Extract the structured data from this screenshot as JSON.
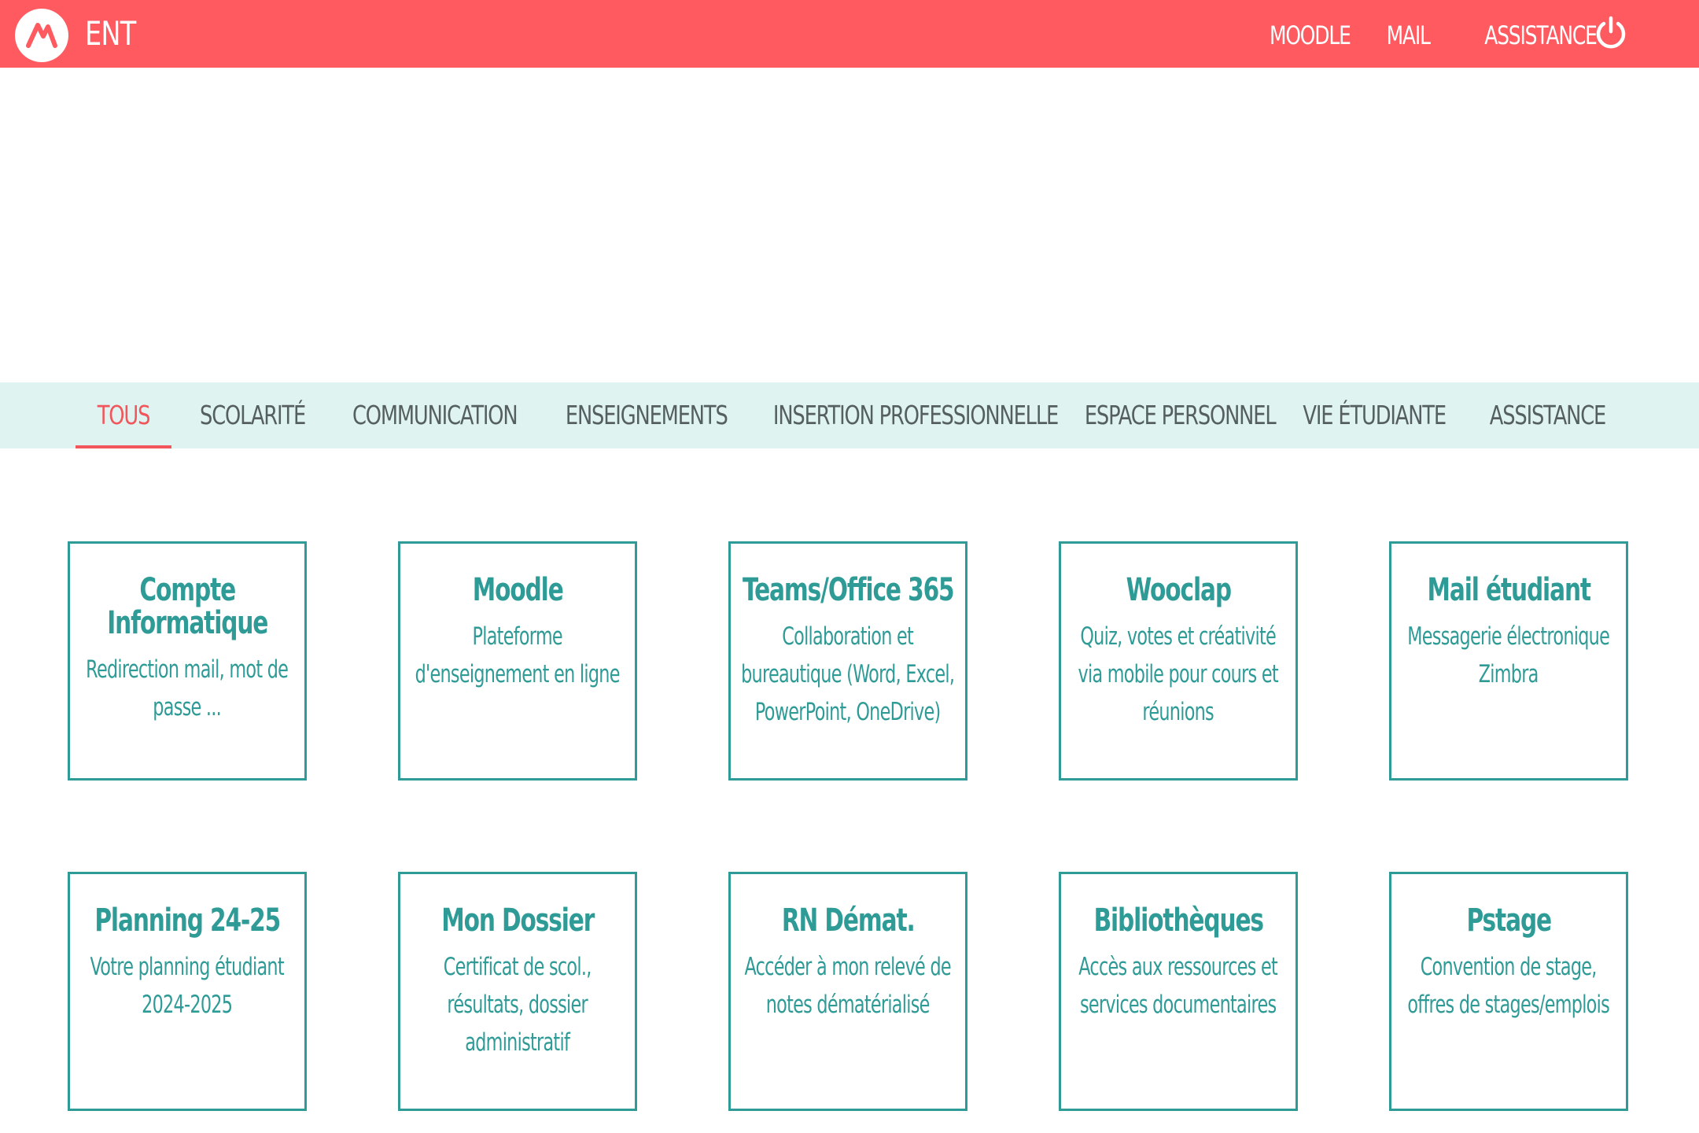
{
  "header": {
    "app_title": "ENT",
    "nav": [
      "MOODLE",
      "MAIL",
      "ASSISTANCE"
    ],
    "logo_icon": "um-logo-icon",
    "logout_icon": "power-icon"
  },
  "tabs": [
    {
      "label": "TOUS",
      "active": true
    },
    {
      "label": "SCOLARITÉ",
      "active": false
    },
    {
      "label": "COMMUNICATION",
      "active": false
    },
    {
      "label": "ENSEIGNEMENTS",
      "active": false
    },
    {
      "label": "INSERTION PROFESSIONNELLE",
      "active": false
    },
    {
      "label": "ESPACE PERSONNEL",
      "active": false
    },
    {
      "label": "VIE ÉTUDIANTE",
      "active": false
    },
    {
      "label": "ASSISTANCE",
      "active": false
    }
  ],
  "cards": [
    {
      "title": "Compte Informatique",
      "desc": "Redirection mail, mot de passe ..."
    },
    {
      "title": "Moodle",
      "desc": "Plateforme d'enseignement en ligne"
    },
    {
      "title": "Teams/Office 365",
      "desc": "Collaboration et bureautique (Word, Excel, PowerPoint, OneDrive)"
    },
    {
      "title": "Wooclap",
      "desc": "Quiz, votes et créativité via mobile pour cours et réunions"
    },
    {
      "title": "Mail étudiant",
      "desc": "Messagerie électronique Zimbra"
    },
    {
      "title": "Planning 24-25",
      "desc": "Votre planning étudiant 2024-2025"
    },
    {
      "title": "Mon Dossier",
      "desc": "Certificat de scol., résultats, dossier administratif"
    },
    {
      "title": "RN Démat.",
      "desc": "Accéder à mon relevé de notes dématérialisé"
    },
    {
      "title": "Bibliothèques",
      "desc": "Accès aux ressources et services documentaires"
    },
    {
      "title": "Pstage",
      "desc": "Convention de stage, offres de stages/emplois"
    }
  ],
  "colors": {
    "brand_red": "#fe5a5f",
    "teal": "#2f9b97",
    "tab_bg": "#dff3f1",
    "tab_text": "#555f60",
    "tab_active": "#f0565b"
  }
}
